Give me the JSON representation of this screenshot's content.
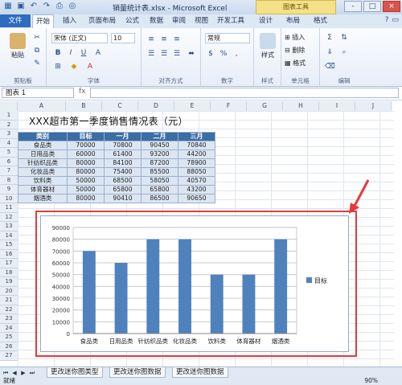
{
  "window": {
    "title": "销量统计表.xlsx - Microsoft Excel",
    "context_tab": "图表工具",
    "buttons": [
      "-",
      "□",
      "×"
    ]
  },
  "tabs": [
    "文件",
    "开始",
    "插入",
    "页面布局",
    "公式",
    "数据",
    "审阅",
    "视图",
    "开发工具",
    "设计",
    "布局",
    "格式"
  ],
  "ribbon": {
    "font_name": "宋体 (正文)",
    "font_size": "10",
    "number_format": "常规",
    "group_labels": [
      "剪贴板",
      "字体",
      "对齐方式",
      "数字",
      "样式",
      "单元格",
      "编辑"
    ],
    "paste_label": "粘贴",
    "style_label": "样式",
    "cell_buttons": [
      "插入",
      "删除",
      "格式"
    ]
  },
  "name_box": "图表 1",
  "columns": [
    "A",
    "B",
    "C",
    "D",
    "E",
    "F",
    "G",
    "H",
    "I",
    "J"
  ],
  "rows": [
    "1",
    "2",
    "3",
    "4",
    "5",
    "6",
    "7",
    "8",
    "9",
    "10",
    "11",
    "12",
    "13",
    "14",
    "15",
    "16",
    "17",
    "18",
    "19",
    "20",
    "21",
    "22",
    "23",
    "24",
    "25",
    "26",
    "27"
  ],
  "sheet": {
    "title": "XXX超市第一季度销售情况表（元）",
    "headers": [
      "类别",
      "目标",
      "一月",
      "二月",
      "三月"
    ],
    "rows": [
      [
        "食品类",
        "70000",
        "70800",
        "90450",
        "70840"
      ],
      [
        "日用品类",
        "60000",
        "61400",
        "93200",
        "44200"
      ],
      [
        "针纺织品类",
        "80000",
        "84100",
        "87200",
        "78900"
      ],
      [
        "化妆品类",
        "80000",
        "75400",
        "85500",
        "88050"
      ],
      [
        "饮料类",
        "50000",
        "68500",
        "58050",
        "40570"
      ],
      [
        "体育器材",
        "50000",
        "65800",
        "65800",
        "43200"
      ],
      [
        "烟酒类",
        "80000",
        "90410",
        "86500",
        "90650"
      ]
    ]
  },
  "chart_data": {
    "type": "bar",
    "categories": [
      "食品类",
      "日用品类",
      "针纺织品类",
      "化妆品类",
      "饮料类",
      "体育器材",
      "烟酒类"
    ],
    "series": [
      {
        "name": "目标",
        "values": [
          70000,
          60000,
          80000,
          80000,
          50000,
          50000,
          80000
        ]
      }
    ],
    "ylim": [
      0,
      90000
    ],
    "yticks": [
      "0",
      "10000",
      "20000",
      "30000",
      "40000",
      "50000",
      "60000",
      "70000",
      "80000",
      "90000"
    ],
    "legend": "right",
    "color": "#4f81bd"
  },
  "sheet_tabs": [
    "更改迷你图类型",
    "更改迷你图数据",
    "更改迷你图数据"
  ],
  "status": {
    "mode": "就绪",
    "zoom": "90%"
  }
}
